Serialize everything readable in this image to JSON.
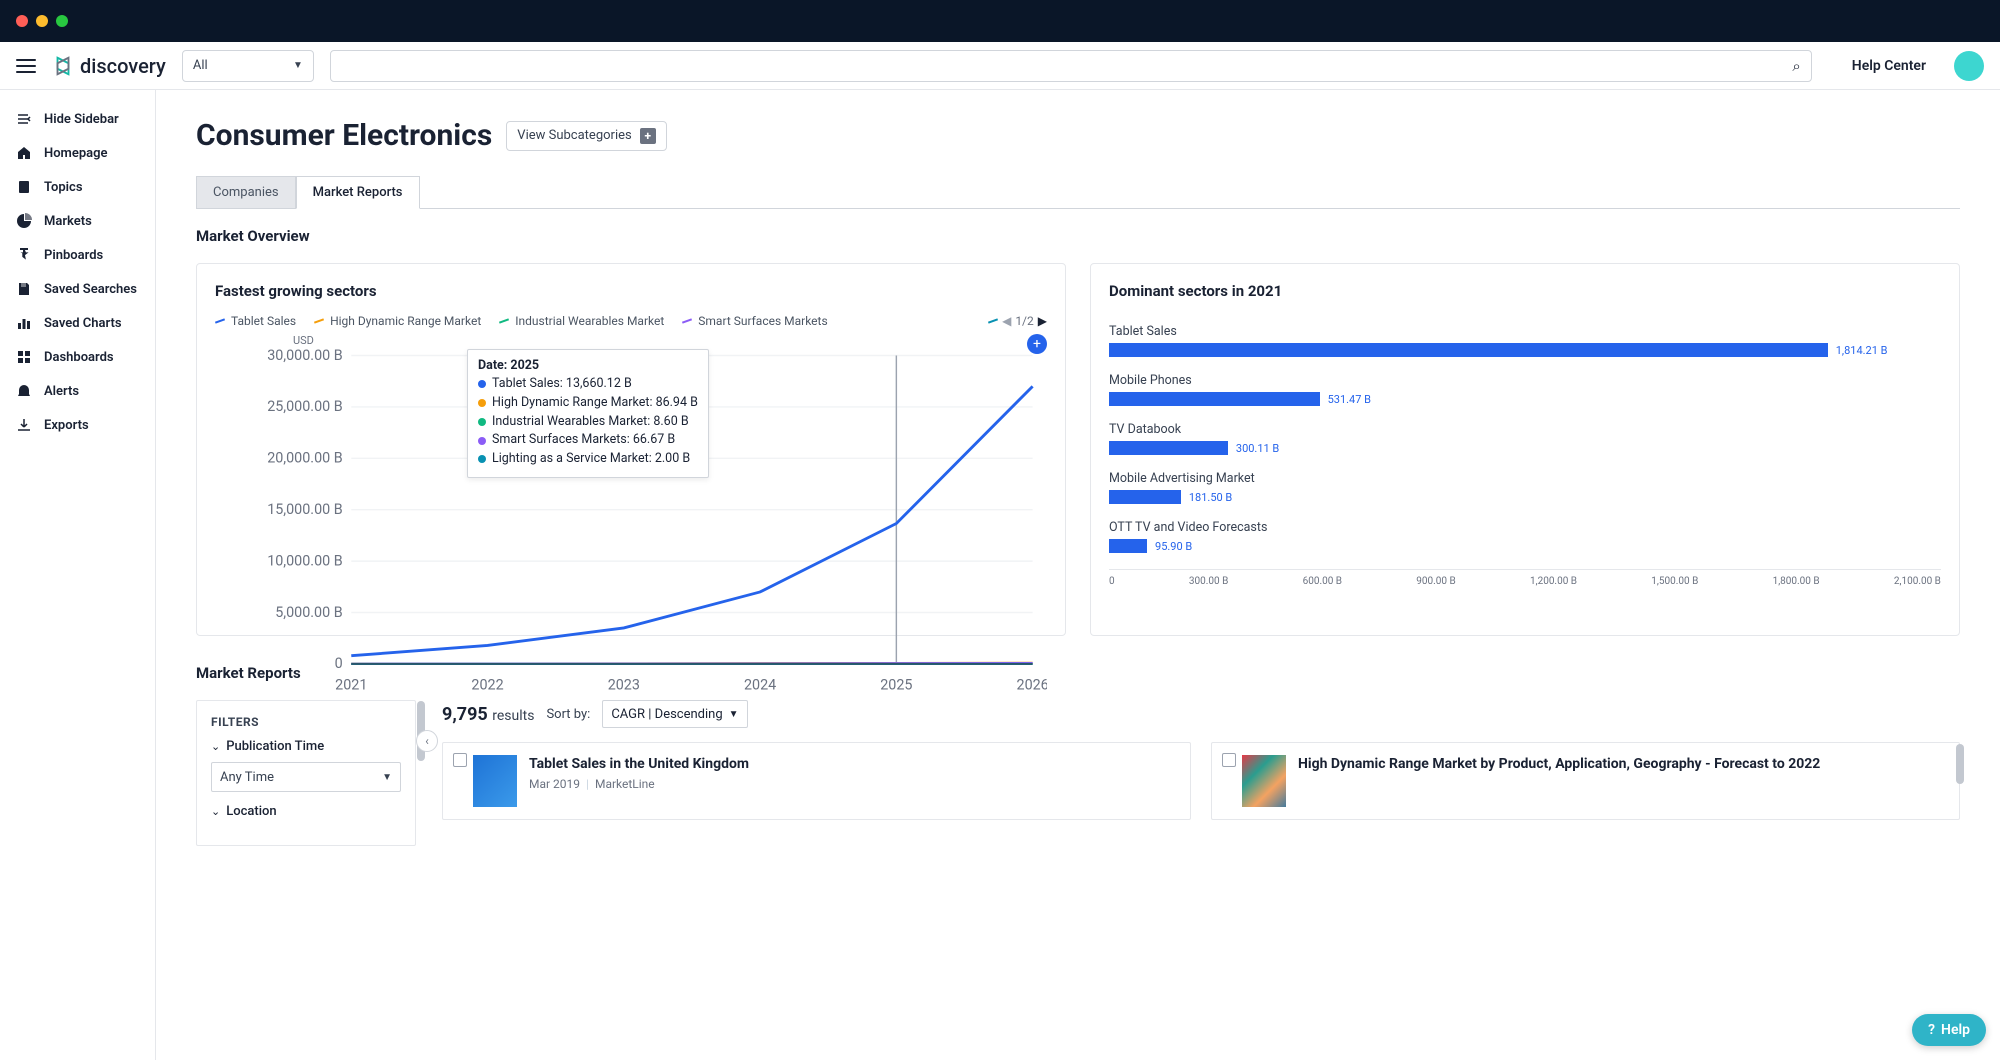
{
  "titlebar": {},
  "topbar": {
    "brand": "discovery",
    "filter_selected": "All",
    "search_placeholder": "",
    "help": "Help Center"
  },
  "sidebar": {
    "items": [
      {
        "icon": "hide",
        "label": "Hide Sidebar"
      },
      {
        "icon": "home",
        "label": "Homepage"
      },
      {
        "icon": "book",
        "label": "Topics"
      },
      {
        "icon": "pie",
        "label": "Markets"
      },
      {
        "icon": "pin",
        "label": "Pinboards"
      },
      {
        "icon": "save",
        "label": "Saved Searches"
      },
      {
        "icon": "bar",
        "label": "Saved Charts"
      },
      {
        "icon": "grid",
        "label": "Dashboards"
      },
      {
        "icon": "bell",
        "label": "Alerts"
      },
      {
        "icon": "download",
        "label": "Exports"
      }
    ]
  },
  "page": {
    "title": "Consumer Electronics",
    "subcategories_btn": "View Subcategories",
    "tabs": [
      "Companies",
      "Market Reports"
    ],
    "active_tab": 1,
    "overview_title": "Market Overview"
  },
  "card1": {
    "title": "Fastest growing sectors",
    "currency": "USD",
    "legend": [
      {
        "name": "Tablet Sales",
        "color": "#2563eb"
      },
      {
        "name": "High Dynamic Range Market",
        "color": "#f59e0b"
      },
      {
        "name": "Industrial Wearables Market",
        "color": "#10b981"
      },
      {
        "name": "Smart Surfaces Markets",
        "color": "#8b5cf6"
      }
    ],
    "pager": "1/2",
    "tooltip": {
      "title": "Date: 2025",
      "rows": [
        {
          "label": "Tablet Sales: 13,660.12 B",
          "color": "#2563eb"
        },
        {
          "label": "High Dynamic Range Market: 86.94 B",
          "color": "#f59e0b"
        },
        {
          "label": "Industrial Wearables Market: 8.60 B",
          "color": "#10b981"
        },
        {
          "label": "Smart Surfaces Markets: 66.67 B",
          "color": "#8b5cf6"
        },
        {
          "label": "Lighting as a Service Market: 2.00 B",
          "color": "#0891b2"
        }
      ]
    }
  },
  "card2": {
    "title": "Dominant sectors in 2021"
  },
  "reports": {
    "section_title": "Market Reports",
    "filters_title": "FILTERS",
    "f1_label": "Publication Time",
    "f1_value": "Any Time",
    "f2_label": "Location",
    "count": "9,795",
    "count_word": "results",
    "sort_label": "Sort by:",
    "sort_value": "CAGR | Descending",
    "cards": [
      {
        "title": "Tablet Sales in the United Kingdom",
        "date": "Mar 2019",
        "source": "MarketLine"
      },
      {
        "title": "High Dynamic Range Market by Product, Application, Geography - Forecast to 2022",
        "date": "",
        "source": ""
      }
    ]
  },
  "help_widget": "Help",
  "chart_data": [
    {
      "type": "line",
      "title": "Fastest growing sectors",
      "x": [
        2021,
        2022,
        2023,
        2024,
        2025,
        2026
      ],
      "ylabel": "USD",
      "ylim": [
        0,
        30000
      ],
      "y_ticks": [
        "0",
        "5,000.00 B",
        "10,000.00 B",
        "15,000.00 B",
        "20,000.00 B",
        "25,000.00 B",
        "30,000.00 B"
      ],
      "series": [
        {
          "name": "Tablet Sales",
          "color": "#2563eb",
          "values": [
            800,
            1800,
            3500,
            7000,
            13660.12,
            27000
          ]
        },
        {
          "name": "High Dynamic Range Market",
          "color": "#f59e0b",
          "values": [
            20,
            35,
            50,
            68,
            86.94,
            110
          ]
        },
        {
          "name": "Industrial Wearables Market",
          "color": "#10b981",
          "values": [
            2,
            3.5,
            5,
            6.8,
            8.6,
            11
          ]
        },
        {
          "name": "Smart Surfaces Markets",
          "color": "#8b5cf6",
          "values": [
            15,
            25,
            38,
            50,
            66.67,
            85
          ]
        },
        {
          "name": "Lighting as a Service Market",
          "color": "#0891b2",
          "values": [
            0.4,
            0.7,
            1.1,
            1.5,
            2.0,
            2.6
          ]
        }
      ]
    },
    {
      "type": "bar",
      "title": "Dominant sectors in 2021",
      "orientation": "horizontal",
      "xlim": [
        0,
        2100
      ],
      "x_ticks": [
        "0",
        "300.00 B",
        "600.00 B",
        "900.00 B",
        "1,200.00 B",
        "1,500.00 B",
        "1,800.00 B",
        "2,100.00 B"
      ],
      "categories": [
        "Tablet Sales",
        "Mobile Phones",
        "TV Databook",
        "Mobile Advertising Market",
        "OTT TV and Video Forecasts"
      ],
      "values": [
        1814.21,
        531.47,
        300.11,
        181.5,
        95.9
      ],
      "value_labels": [
        "1,814.21 B",
        "531.47 B",
        "300.11 B",
        "181.50 B",
        "95.90 B"
      ]
    }
  ]
}
